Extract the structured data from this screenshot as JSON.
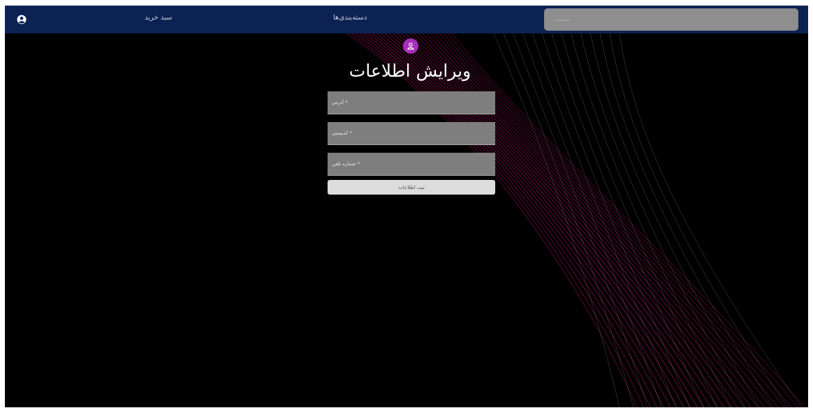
{
  "navbar": {
    "account_icon": "user-circle-icon",
    "cart_label": "سبد خرید",
    "categories_label": "دسته‌بندی‌ها",
    "search_placeholder": "جستجو..."
  },
  "profile": {
    "avatar_icon": "user-icon",
    "title": "ویرایش اطلاعات"
  },
  "form": {
    "address_placeholder": "* آدرس",
    "postal_code_placeholder": "* کدپستی",
    "phone_placeholder": "* شماره تلفن",
    "submit_label": "ثبت اطلاعات"
  },
  "colors": {
    "navbar": "#0b2252",
    "background": "#000000",
    "avatar": "#a52fb8",
    "field": "#7e7e7e",
    "button": "#dcdcdc",
    "accent_wave": "#c2186b"
  }
}
